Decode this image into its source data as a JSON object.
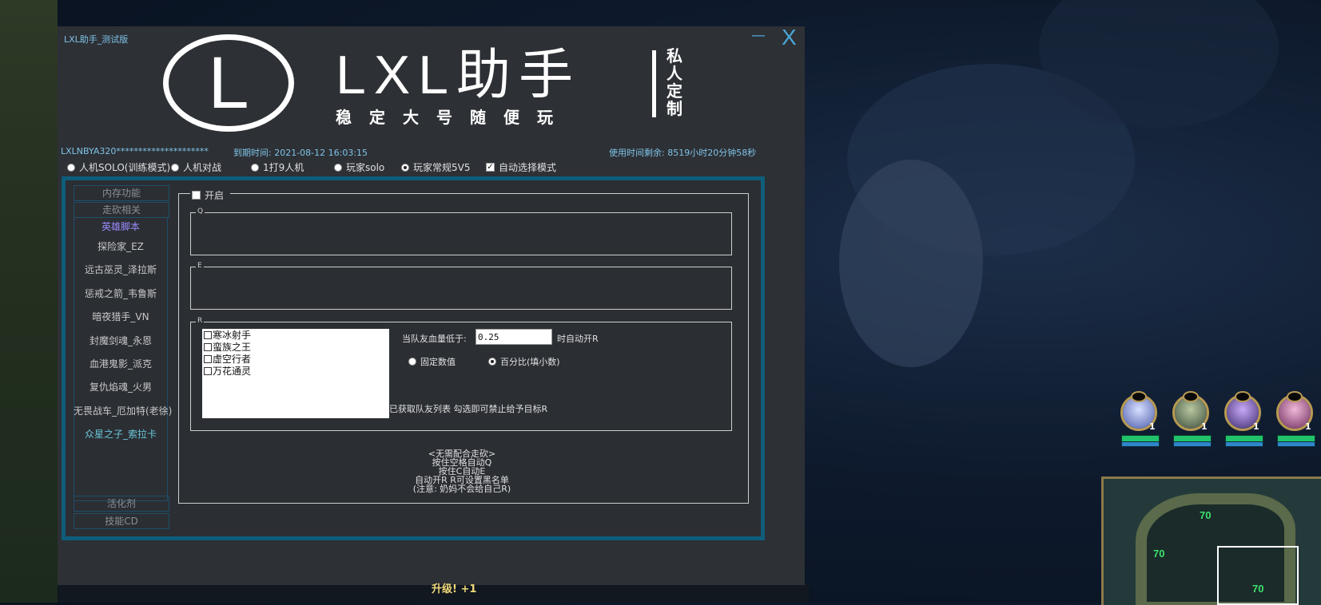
{
  "window": {
    "title": "LXL助手_测试版",
    "minimize_label": "—",
    "close_label": "X"
  },
  "logo": {
    "letter": "L",
    "main": "LXL助手",
    "sub": "稳定大号随便玩",
    "side": "私人定制"
  },
  "status": {
    "user": "LXLNBYA320*********************",
    "expire": "到期时间: 2021-08-12 16:03:15",
    "remaining": "使用时间剩余: 8519小时20分钟58秒"
  },
  "modes": [
    {
      "label": "人机SOLO(训练模式)",
      "checked": false
    },
    {
      "label": "人机对战",
      "checked": false
    },
    {
      "label": "1打9人机",
      "checked": false
    },
    {
      "label": "玩家solo",
      "checked": false
    },
    {
      "label": "玩家常规5V5",
      "checked": true
    }
  ],
  "auto_select": {
    "label": "自动选择模式",
    "checked": true
  },
  "sidebar": {
    "top": [
      "内存功能",
      "走砍相关",
      "英雄脚本"
    ],
    "heroes": [
      "探险家_EZ",
      "远古巫灵_泽拉斯",
      "惩戒之箭_韦鲁斯",
      "暗夜猎手_VN",
      "封魔剑魂_永恩",
      "血港鬼影_派克",
      "复仇焰魂_火男",
      "无畏战车_厄加特(老徐)",
      "众星之子_索拉卡"
    ],
    "bottom": [
      "活化剂",
      "技能CD"
    ]
  },
  "panel": {
    "enable_label": "开启",
    "q_label": "Q",
    "e_label": "E",
    "r_label": "R",
    "teammates": [
      "寒冰射手",
      "蛮族之王",
      "虚空行者",
      "万花通灵"
    ],
    "hp_prefix": "当队友血量低于:",
    "hp_value": "0.25",
    "hp_suffix": "时自动开R",
    "option_fixed": "固定数值",
    "option_percent": "百分比(填小数)",
    "percent_selected": true,
    "list_hint": "已获取队友列表 勾选即可禁止给予目标R"
  },
  "notes": [
    "<无需配合走砍>",
    "按住空格自动Q",
    "按住C自动E",
    "自动开R R可设置黑名单",
    "(注意: 奶妈不会给自己R)"
  ],
  "game": {
    "hero_levels": [
      "1",
      "1",
      "1",
      "1"
    ],
    "minimap_numbers": [
      "70",
      "70",
      "70"
    ],
    "levelup_text": "升级! +1"
  }
}
